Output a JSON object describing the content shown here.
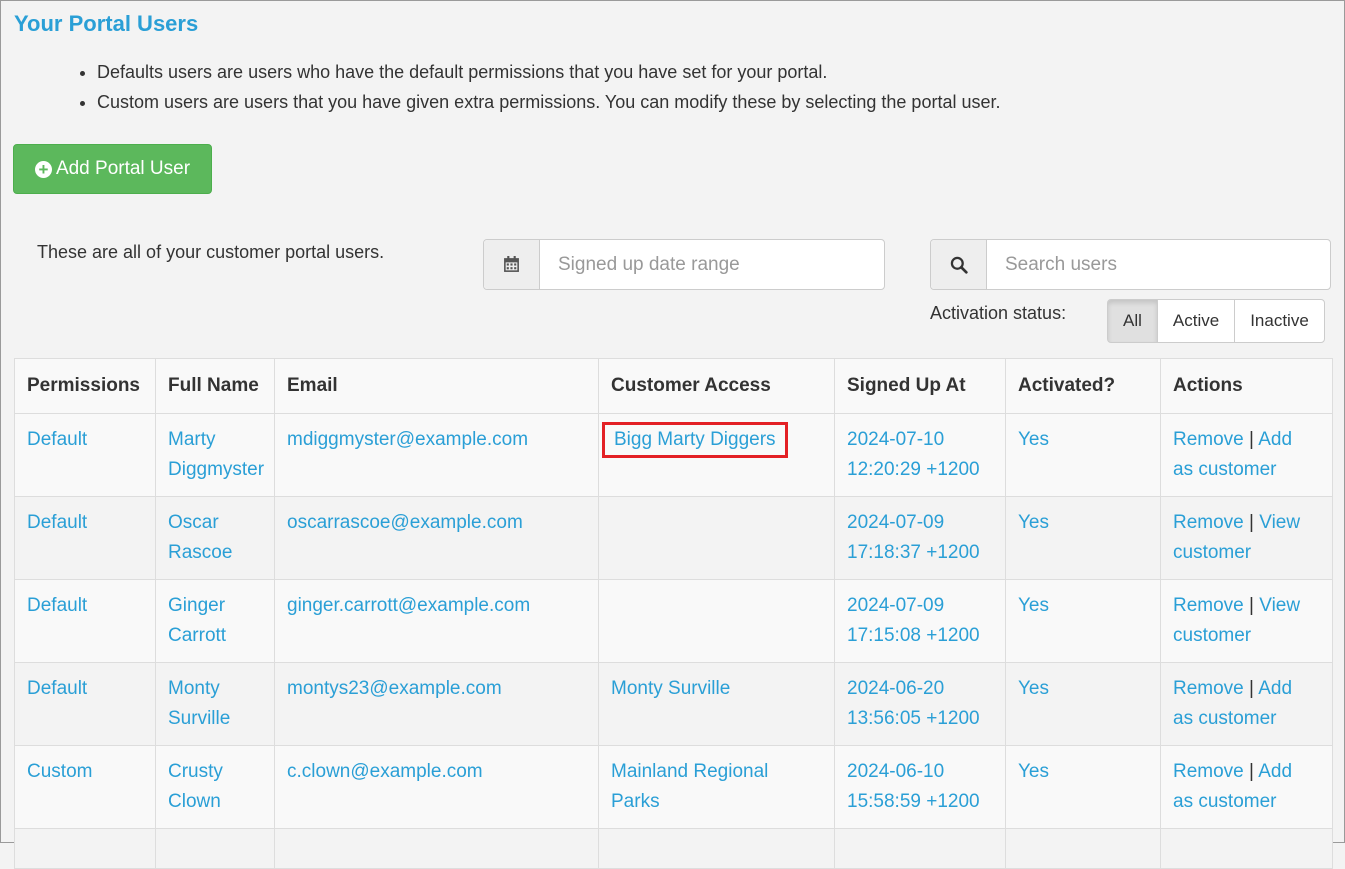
{
  "page": {
    "title": "Your Portal Users",
    "notes": [
      "Defaults users are users who have the default permissions that you have set for your portal.",
      "Custom users are users that you have given extra permissions. You can modify these by selecting the portal user."
    ],
    "add_button_label": "Add Portal User",
    "intro_text": "These are all of your customer portal users."
  },
  "filters": {
    "date_placeholder": "Signed up date range",
    "search_placeholder": "Search users",
    "activation_label": "Activation status:",
    "activation_options": [
      "All",
      "Active",
      "Inactive"
    ],
    "activation_selected": "All"
  },
  "table": {
    "headers": [
      "Permissions",
      "Full Name",
      "Email",
      "Customer Access",
      "Signed Up At",
      "Activated?",
      "Actions"
    ],
    "rows": [
      {
        "permissions": "Default",
        "name1": "Marty",
        "name2": "Diggmyster",
        "email": "mdiggmyster@example.com",
        "access1": "Bigg Marty Diggers",
        "access2": "",
        "date1": "2024-07-10",
        "date2": "12:20:29 +1200",
        "activated": "Yes",
        "remove": "Remove",
        "sep": "|",
        "act1": "Add",
        "act2": "as customer"
      },
      {
        "permissions": "Default",
        "name1": "Oscar",
        "name2": "Rascoe",
        "email": "oscarrascoe@example.com",
        "access1": "",
        "access2": "",
        "date1": "2024-07-09",
        "date2": "17:18:37 +1200",
        "activated": "Yes",
        "remove": "Remove",
        "sep": "|",
        "act1": "View",
        "act2": "customer"
      },
      {
        "permissions": "Default",
        "name1": "Ginger",
        "name2": "Carrott",
        "email": "ginger.carrott@example.com",
        "access1": "",
        "access2": "",
        "date1": "2024-07-09",
        "date2": "17:15:08 +1200",
        "activated": "Yes",
        "remove": "Remove",
        "sep": "|",
        "act1": "View",
        "act2": "customer"
      },
      {
        "permissions": "Default",
        "name1": "Monty",
        "name2": "Surville",
        "email": "montys23@example.com",
        "access1": "Monty Surville",
        "access2": "",
        "date1": "2024-06-20",
        "date2": "13:56:05 +1200",
        "activated": "Yes",
        "remove": "Remove",
        "sep": "|",
        "act1": "Add",
        "act2": "as customer"
      },
      {
        "permissions": "Custom",
        "name1": "Crusty",
        "name2": "Clown",
        "email": "c.clown@example.com",
        "access1": "Mainland Regional",
        "access2": "Parks",
        "date1": "2024-06-10",
        "date2": "15:58:59 +1200",
        "activated": "Yes",
        "remove": "Remove",
        "sep": "|",
        "act1": "Add",
        "act2": "as customer"
      }
    ]
  },
  "colors": {
    "accent": "#2a9fd6",
    "success": "#5cb85c",
    "highlight_border": "#e32025"
  },
  "icons": [
    "plus-circle-icon",
    "calendar-icon",
    "search-icon"
  ]
}
